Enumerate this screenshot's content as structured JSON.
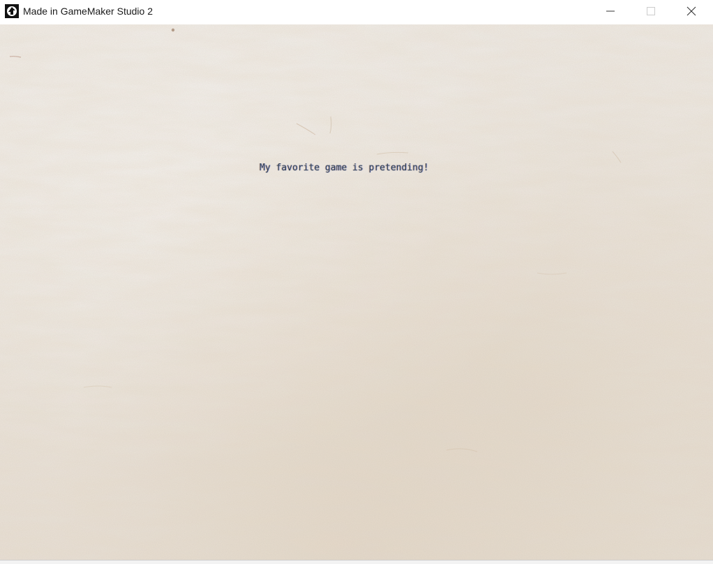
{
  "window": {
    "title": "Made in GameMaker Studio 2",
    "icon": "gamemaker-logo-icon",
    "controls": {
      "minimize": "minimize-icon",
      "maximize": "maximize-icon",
      "close": "close-icon"
    }
  },
  "game": {
    "dialog_text": "My favorite game is pretending!",
    "background": "paper-texture",
    "colors": {
      "paper": "#ede8e2",
      "text": "#2e3f57"
    }
  }
}
